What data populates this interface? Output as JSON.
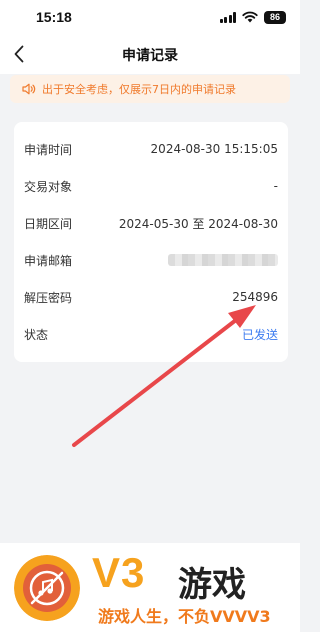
{
  "status_bar": {
    "time": "15:18",
    "battery": "86"
  },
  "nav": {
    "title": "申请记录",
    "back_icon": "chevron-left-icon"
  },
  "notice": {
    "icon": "speaker-icon",
    "text": "出于安全考虑，仅展示7日内的申请记录"
  },
  "record": {
    "rows": [
      {
        "label": "申请时间",
        "value": "2024-08-30 15:15:05"
      },
      {
        "label": "交易对象",
        "value": "-"
      },
      {
        "label": "日期区间",
        "value": "2024-05-30 至 2024-08-30"
      },
      {
        "label": "申请邮箱",
        "value": ""
      },
      {
        "label": "解压密码",
        "value": "254896"
      },
      {
        "label": "状态",
        "value": "已发送"
      }
    ]
  },
  "watermark": {
    "brand": "V3",
    "name": "游戏",
    "slogan": "游戏人生，不负VVVV3"
  },
  "colors": {
    "accent_orange": "#f07a2c",
    "link_blue": "#3d7cf0",
    "arrow_red": "#e8474a",
    "brand_yellow": "#f6a21e"
  }
}
